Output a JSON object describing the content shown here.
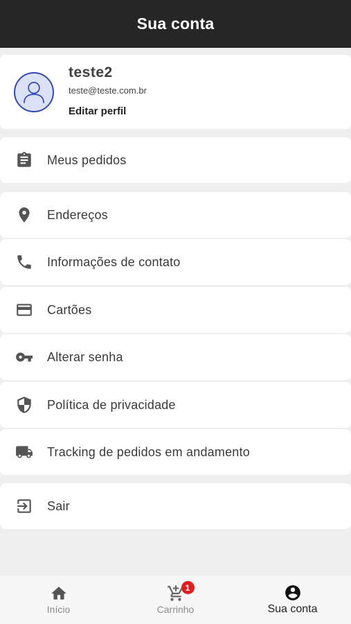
{
  "header": {
    "title": "Sua conta"
  },
  "profile": {
    "name": "teste2",
    "email": "teste@teste.com.br",
    "edit_label": "Editar perfil",
    "avatar_icon": "user-avatar-icon"
  },
  "menu": {
    "orders": {
      "label": "Meus pedidos",
      "icon": "clipboard-icon"
    },
    "addresses": {
      "label": "Endereços",
      "icon": "location-pin-icon"
    },
    "contact": {
      "label": "Informações de contato",
      "icon": "phone-icon"
    },
    "cards": {
      "label": "Cartões",
      "icon": "credit-card-icon"
    },
    "password": {
      "label": "Alterar senha",
      "icon": "key-icon"
    },
    "privacy": {
      "label": "Política de privacidade",
      "icon": "shield-icon"
    },
    "tracking": {
      "label": "Tracking de pedidos em andamento",
      "icon": "truck-icon"
    },
    "logout": {
      "label": "Sair",
      "icon": "exit-icon"
    }
  },
  "bottom_nav": {
    "home": {
      "label": "Início",
      "icon": "home-icon"
    },
    "cart": {
      "label": "Carrinho",
      "icon": "cart-icon",
      "badge": "1"
    },
    "account": {
      "label": "Sua conta",
      "icon": "account-circle-icon",
      "active": true
    }
  },
  "colors": {
    "header_bg": "#262626",
    "accent": "#3347b8",
    "badge": "#e02020",
    "page_bg": "#efefef"
  }
}
